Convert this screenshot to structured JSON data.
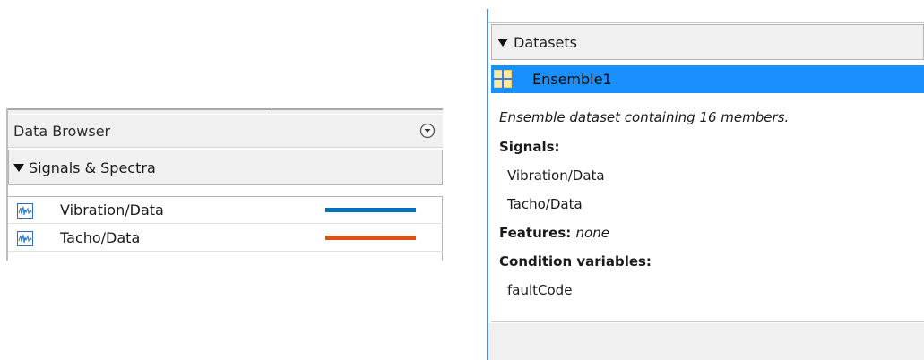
{
  "data_browser": {
    "title": "Data Browser",
    "menu_icon": "circle-chevron-down-icon",
    "section": {
      "label": "Signals & Spectra",
      "expanded": true
    },
    "signals": [
      {
        "label": "Vibration/Data",
        "icon": "signal-plot-icon",
        "color": "#0072bd"
      },
      {
        "label": "Tacho/Data",
        "icon": "signal-plot-icon",
        "color": "#d95319"
      }
    ]
  },
  "datasets": {
    "header_label": "Datasets",
    "expanded": true,
    "items": [
      {
        "label": "Ensemble1",
        "icon": "ensemble-grid-icon",
        "selected": true,
        "selection_color": "#1a90ff"
      }
    ],
    "details": {
      "description": "Ensemble dataset containing 16 members.",
      "signals_heading": "Signals:",
      "signals": [
        "Vibration/Data",
        "Tacho/Data"
      ],
      "features_heading": "Features:",
      "features_value": "none",
      "condition_heading": "Condition variables:",
      "condition_variables": [
        "faultCode"
      ]
    }
  }
}
